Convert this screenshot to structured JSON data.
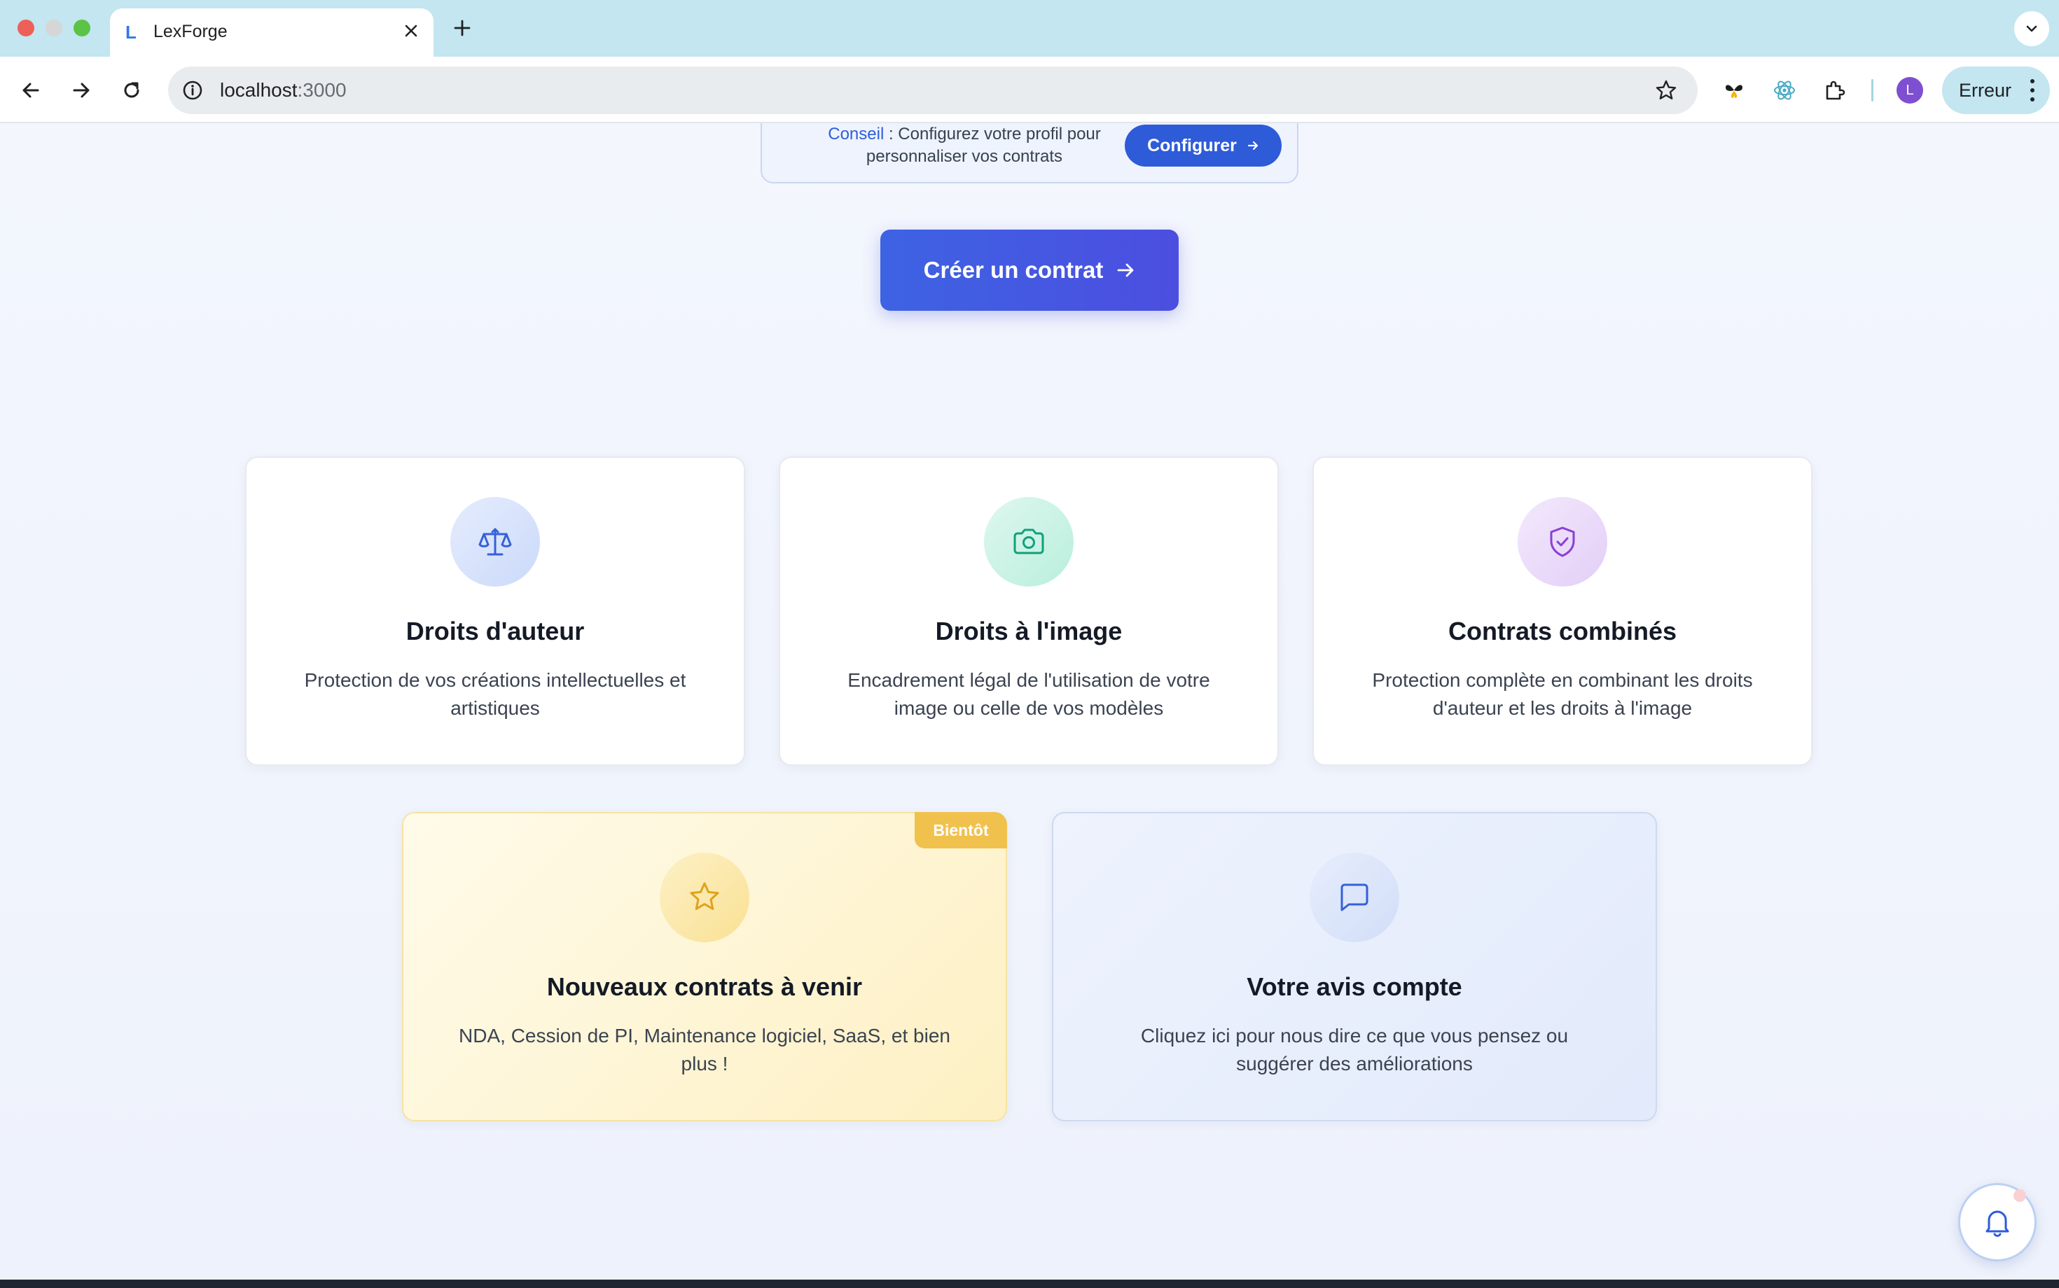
{
  "browser": {
    "tab_title": "LexForge",
    "tab_favicon": "L",
    "url_host": "localhost",
    "url_port": ":3000",
    "profile_initial": "L",
    "error_label": "Erreur"
  },
  "tip": {
    "label": "Conseil",
    "text": " : Configurez votre profil pour personnaliser vos contrats",
    "button_label": "Configurer"
  },
  "cta": {
    "label": "Créer un contrat"
  },
  "cards": [
    {
      "title": "Droits d'auteur",
      "description": "Protection de vos créations intellectuelles et artistiques",
      "icon": "scale-icon"
    },
    {
      "title": "Droits à l'image",
      "description": "Encadrement légal de l'utilisation de votre image ou celle de vos modèles",
      "icon": "camera-icon"
    },
    {
      "title": "Contrats combinés",
      "description": "Protection complète en combinant les droits d'auteur et les droits à l'image",
      "icon": "shield-check-icon"
    },
    {
      "title": "Nouveaux contrats à venir",
      "description": "NDA, Cession de PI, Maintenance logiciel, SaaS, et bien plus !",
      "badge": "Bientôt",
      "icon": "star-icon"
    },
    {
      "title": "Votre avis compte",
      "description": "Cliquez ici pour nous dire ce que vous pensez ou suggérer des améliorations",
      "icon": "message-icon"
    }
  ],
  "colors": {
    "primary": "#2e5bd8",
    "cta_start": "#3d63e3",
    "cta_end": "#4c4ee0",
    "badge": "#f1c14d",
    "page_background": "#f2f5fc",
    "tabstrip": "#c3e6f0"
  }
}
